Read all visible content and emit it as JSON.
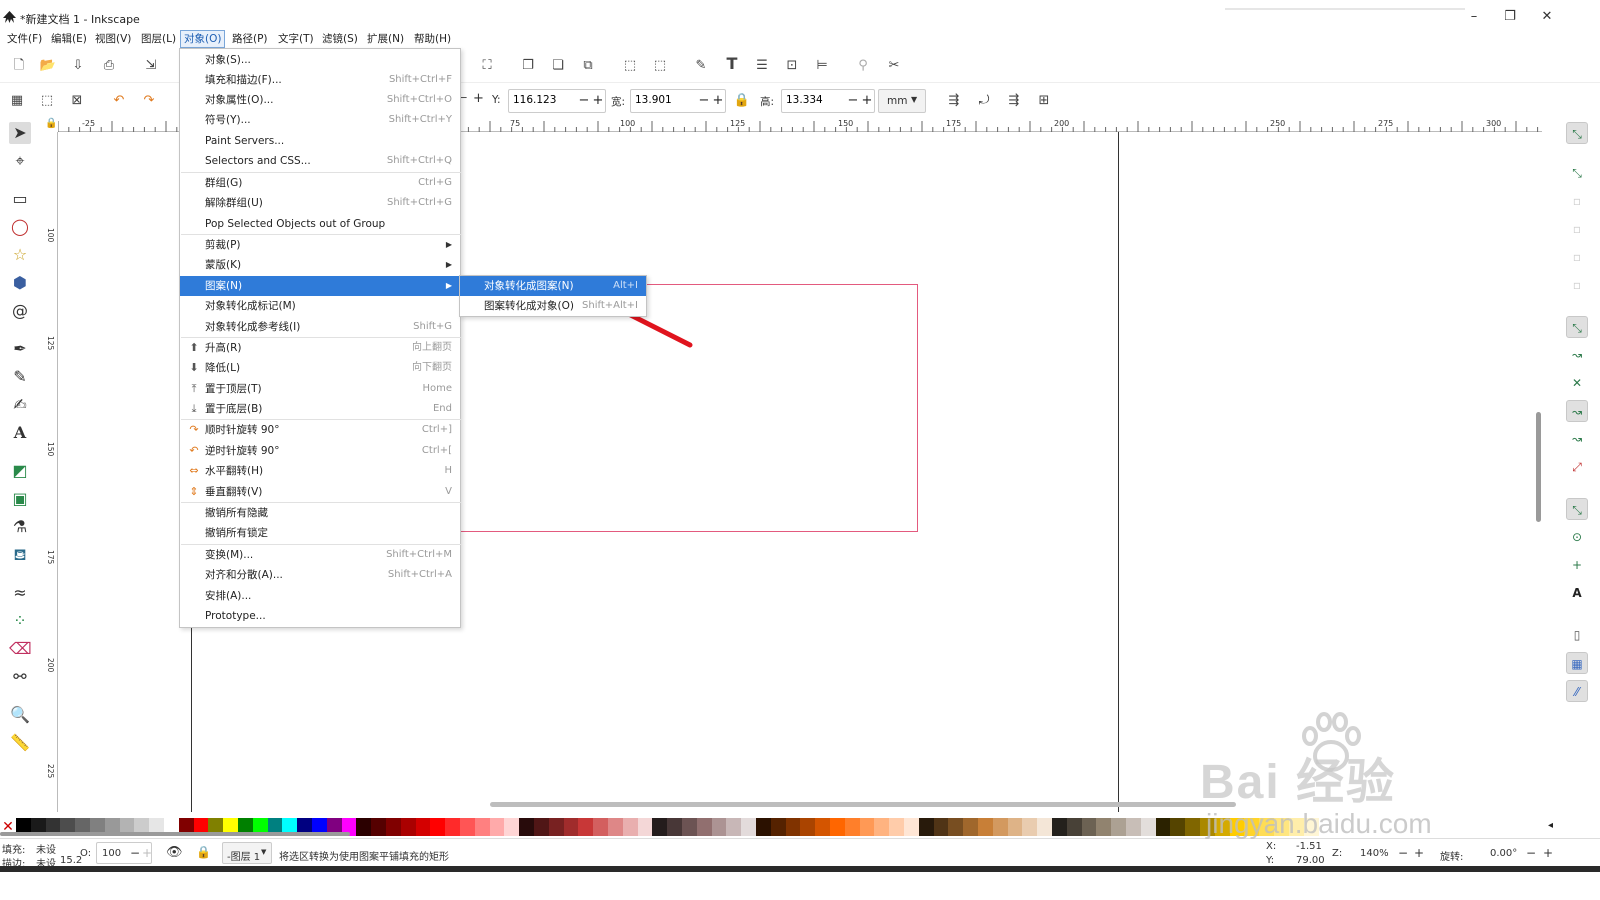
{
  "window": {
    "title": "*新建文档 1 - Inkscape",
    "minimize": "–",
    "maximize": "❐",
    "close": "✕"
  },
  "menubar": [
    "文件(F)",
    "编辑(E)",
    "视图(V)",
    "图层(L)",
    "对象(O)",
    "路径(P)",
    "文字(T)",
    "滤镜(S)",
    "扩展(N)",
    "帮助(H)"
  ],
  "controls": {
    "y_label": "Y:",
    "y_value": "116.123",
    "w_label": "宽:",
    "w_value": "13.901",
    "h_label": "高:",
    "h_value": "13.334",
    "unit": "mm"
  },
  "ruler": {
    "h_ticks": [
      "-25",
      "75",
      "100",
      "125",
      "150",
      "175",
      "200",
      "250",
      "275",
      "300"
    ],
    "v_ticks": [
      "100",
      "125",
      "150",
      "175",
      "200",
      "225",
      "250"
    ]
  },
  "object_menu": {
    "items": [
      {
        "label": "对象(S)...",
        "accel": ""
      },
      {
        "label": "填充和描边(F)...",
        "accel": "Shift+Ctrl+F"
      },
      {
        "label": "对象属性(O)...",
        "accel": "Shift+Ctrl+O"
      },
      {
        "label": "符号(Y)...",
        "accel": "Shift+Ctrl+Y"
      },
      {
        "label": "Paint Servers...",
        "accel": ""
      },
      {
        "label": "Selectors and CSS...",
        "accel": "Shift+Ctrl+Q"
      },
      {
        "label": "群组(G)",
        "accel": "Ctrl+G"
      },
      {
        "label": "解除群组(U)",
        "accel": "Shift+Ctrl+G"
      },
      {
        "label": "Pop Selected Objects out of Group",
        "accel": ""
      },
      {
        "label": "剪裁(P)",
        "accel": ""
      },
      {
        "label": "蒙版(K)",
        "accel": ""
      },
      {
        "label": "图案(N)",
        "accel": ""
      },
      {
        "label": "对象转化成标记(M)",
        "accel": ""
      },
      {
        "label": "对象转化成参考线(I)",
        "accel": "Shift+G"
      },
      {
        "label": "升高(R)",
        "accel": "向上翻页"
      },
      {
        "label": "降低(L)",
        "accel": "向下翻页"
      },
      {
        "label": "置于顶层(T)",
        "accel": "Home"
      },
      {
        "label": "置于底层(B)",
        "accel": "End"
      },
      {
        "label": "顺时针旋转 90°",
        "accel": "Ctrl+]"
      },
      {
        "label": "逆时针旋转 90°",
        "accel": "Ctrl+["
      },
      {
        "label": "水平翻转(H)",
        "accel": "H"
      },
      {
        "label": "垂直翻转(V)",
        "accel": "V"
      },
      {
        "label": "撤销所有隐藏",
        "accel": ""
      },
      {
        "label": "撤销所有锁定",
        "accel": ""
      },
      {
        "label": "变换(M)...",
        "accel": "Shift+Ctrl+M"
      },
      {
        "label": "对齐和分散(A)...",
        "accel": "Shift+Ctrl+A"
      },
      {
        "label": "安排(A)...",
        "accel": ""
      },
      {
        "label": "Prototype...",
        "accel": ""
      }
    ]
  },
  "pattern_submenu": {
    "items": [
      {
        "label": "对象转化成图案(N)",
        "accel": "Alt+I"
      },
      {
        "label": "图案转化成对象(O)",
        "accel": "Shift+Alt+I"
      }
    ]
  },
  "status": {
    "fill_label": "填充:",
    "fill_value": "未设",
    "stroke_label": "描边:",
    "stroke_value": "未设",
    "stroke_width": "15.2",
    "opacity_label": "O:",
    "opacity_value": "100",
    "layer": "-图层 1",
    "message": "将选区转换为使用图案平铺填充的矩形",
    "x_label": "X:",
    "x_value": "-1.51",
    "y_label": "Y:",
    "y_value": "79.00",
    "z_label": "Z:",
    "zoom": "140%",
    "rot_label": "旋转:",
    "rotation": "0.00°"
  },
  "watermark": {
    "line1": "Bai 经验",
    "line2": "jingyan.baidu.com"
  },
  "colors": {
    "accent": "#2f7bd9",
    "selection_rect": "#e35a7e",
    "arrow": "#e0141e"
  }
}
